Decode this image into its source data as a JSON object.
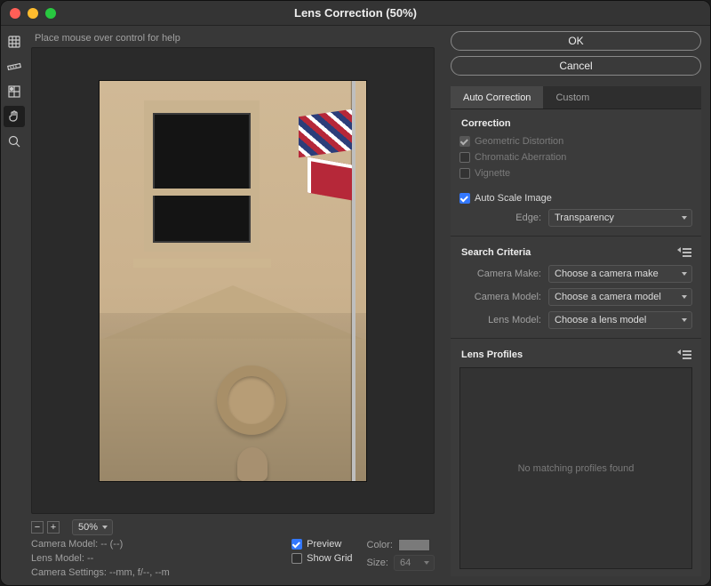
{
  "window": {
    "title": "Lens Correction (50%)"
  },
  "hint": "Place mouse over control for help",
  "buttons": {
    "ok": "OK",
    "cancel": "Cancel"
  },
  "tabs": {
    "auto": "Auto Correction",
    "custom": "Custom"
  },
  "correction": {
    "heading": "Correction",
    "geometric": "Geometric Distortion",
    "chromatic": "Chromatic Aberration",
    "vignette": "Vignette",
    "autoscale": "Auto Scale Image",
    "edge_label": "Edge:",
    "edge_value": "Transparency"
  },
  "search": {
    "heading": "Search Criteria",
    "make_label": "Camera Make:",
    "make_value": "Choose a camera make",
    "model_label": "Camera Model:",
    "model_value": "Choose a camera model",
    "lens_label": "Lens Model:",
    "lens_value": "Choose a lens model"
  },
  "profiles": {
    "heading": "Lens Profiles",
    "empty": "No matching profiles found"
  },
  "footer": {
    "zoom": "50%",
    "cam_model": "Camera Model: -- (--)",
    "lens_model": "Lens Model: --",
    "cam_settings": "Camera Settings: --mm, f/--, --m",
    "preview": "Preview",
    "show_grid": "Show Grid",
    "color_label": "Color:",
    "size_label": "Size:",
    "size_value": "64"
  }
}
